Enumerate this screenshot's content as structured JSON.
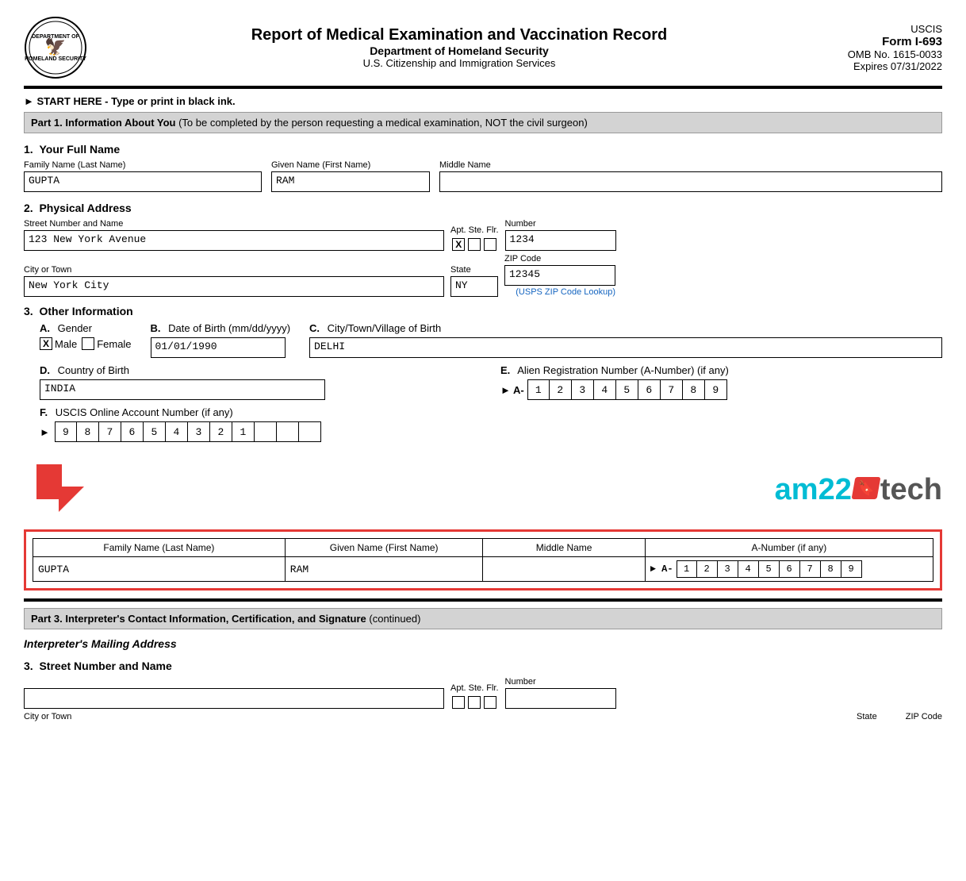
{
  "header": {
    "title": "Report of Medical Examination and Vaccination Record",
    "dept": "Department of Homeland Security",
    "agency": "U.S. Citizenship and Immigration Services",
    "form_id": "USCIS",
    "form_number": "Form I-693",
    "omb": "OMB No. 1615-0033",
    "expires": "Expires 07/31/2022"
  },
  "start_here": "► START HERE - Type or print in black ink.",
  "part1": {
    "header": "Part 1.  Information About You",
    "header_suffix": " (To be completed by the person requesting a medical examination, NOT the civil surgeon)",
    "section1": {
      "number": "1.",
      "label": "Your Full Name",
      "family_label": "Family Name (Last Name)",
      "family_value": "GUPTA",
      "given_label": "Given Name (First Name)",
      "given_value": "RAM",
      "middle_label": "Middle Name",
      "middle_value": ""
    },
    "section2": {
      "number": "2.",
      "label": "Physical Address",
      "street_label": "Street Number and Name",
      "street_value": "123 New York Avenue",
      "apt_label": "Apt. Ste. Flr.",
      "apt_x": "X",
      "apt_ste": "",
      "apt_flr": "",
      "number_label": "Number",
      "number_value": "1234",
      "city_label": "City or Town",
      "city_value": "New York City",
      "state_label": "State",
      "state_value": "NY",
      "zip_label": "ZIP Code",
      "zip_value": "12345",
      "usps_link": "(USPS ZIP Code Lookup)"
    },
    "section3": {
      "number": "3.",
      "label": "Other Information",
      "gender": {
        "label_a": "A.",
        "title": "Gender",
        "male_checked": true,
        "male_label": "Male",
        "female_checked": false,
        "female_label": "Female"
      },
      "dob": {
        "label_b": "B.",
        "title": "Date of Birth (mm/dd/yyyy)",
        "value": "01/01/1990"
      },
      "city_birth": {
        "label_c": "C.",
        "title": "City/Town/Village of Birth",
        "value": "DELHI"
      },
      "country_birth": {
        "label_d": "D.",
        "title": "Country of Birth",
        "value": "INDIA"
      },
      "alien_number": {
        "label_e": "E.",
        "title": "Alien Registration Number (A-Number) (if any)",
        "prefix": "► A-",
        "digits": [
          "1",
          "2",
          "3",
          "4",
          "5",
          "6",
          "7",
          "8",
          "9"
        ]
      },
      "online_account": {
        "label_f": "F.",
        "title": "USCIS Online Account Number (if any)",
        "prefix": "►",
        "digits": [
          "9",
          "8",
          "7",
          "6",
          "5",
          "4",
          "3",
          "2",
          "1"
        ]
      }
    }
  },
  "branding": {
    "am22_text": "am22",
    "tech_text": "tech"
  },
  "footer_repeat": {
    "col1_header": "Family Name (Last Name)",
    "col2_header": "Given Name (First Name)",
    "col3_header": "Middle Name",
    "col4_header": "A-Number (if any)",
    "family_value": "GUPTA",
    "given_value": "RAM",
    "middle_value": "",
    "a_prefix": "► A-",
    "a_digits": [
      "1",
      "2",
      "3",
      "4",
      "5",
      "6",
      "7",
      "8",
      "9"
    ]
  },
  "part3": {
    "header": "Part 3.  Interpreter's Contact Information, Certification, and Signature",
    "header_suffix": " (continued)",
    "mailing_address_label": "Interpreter's Mailing Address",
    "section3": {
      "number": "3.",
      "label": "Street Number and Name",
      "street_value": "",
      "apt_label": "Apt. Ste. Flr.",
      "number_label": "Number",
      "number_value": "",
      "city_label": "City or Town",
      "state_label": "State",
      "zip_label": "ZIP Code"
    }
  }
}
